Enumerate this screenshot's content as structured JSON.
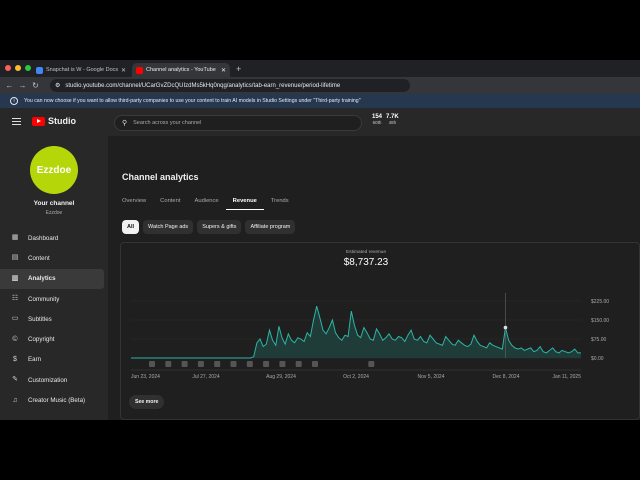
{
  "browser": {
    "tabs": [
      {
        "label": "Snapchat is W - Google Docs",
        "favicon_color": "#4285f4"
      },
      {
        "label": "Channel analytics - YouTube",
        "favicon_color": "#ff0000"
      }
    ],
    "url": "studio.youtube.com/channel/UCarGvZDcQUIzdMs5kHq0nqg/analytics/tab-earn_revenue/period-lifetime"
  },
  "banner": {
    "text": "You can now choose if you want to allow third-party companies to use your content to train AI models in Studio Settings under \"Third-party training\""
  },
  "header": {
    "logo_text": "Studio",
    "search_placeholder": "Search across your channel",
    "stats": [
      {
        "value": "154",
        "label": "60th"
      },
      {
        "value": "7.7K",
        "label": "48h"
      }
    ]
  },
  "sidebar": {
    "avatar_text": "Ezzdoe",
    "channel_label": "Your channel",
    "channel_handle": "Ezzdoe",
    "items": [
      {
        "label": "Dashboard",
        "icon": "dashboard-icon",
        "glyph": "▦"
      },
      {
        "label": "Content",
        "icon": "content-icon",
        "glyph": "▤"
      },
      {
        "label": "Analytics",
        "icon": "analytics-icon",
        "glyph": "▥"
      },
      {
        "label": "Community",
        "icon": "community-icon",
        "glyph": "☷"
      },
      {
        "label": "Subtitles",
        "icon": "subtitles-icon",
        "glyph": "▭"
      },
      {
        "label": "Copyright",
        "icon": "copyright-icon",
        "glyph": "©"
      },
      {
        "label": "Earn",
        "icon": "earn-icon",
        "glyph": "$"
      },
      {
        "label": "Customization",
        "icon": "customization-icon",
        "glyph": "✎"
      },
      {
        "label": "Creator Music (Beta)",
        "icon": "music-icon",
        "glyph": "♫"
      }
    ]
  },
  "main": {
    "title": "Channel analytics",
    "tabs": [
      "Overview",
      "Content",
      "Audience",
      "Revenue",
      "Trends"
    ],
    "chips": [
      "All",
      "Watch Page ads",
      "Supers & gifts",
      "Affiliate program"
    ],
    "metric_label": "Estimated revenue",
    "metric_value": "$8,737.23",
    "see_more": "See more"
  },
  "colors": {
    "accent_line": "#2bb5a5",
    "chip_selected_bg": "#f1f1f1",
    "avatar": "#b5d70a"
  },
  "chart_data": {
    "type": "area",
    "x_tick_labels": [
      "Jun 23, 2024",
      "Jul 27, 2024",
      "Aug 29, 2024",
      "Oct 2, 2024",
      "Nov 5, 2024",
      "Dec 8, 2024",
      "Jan 11, 2025"
    ],
    "y_tick_labels": [
      "$225.00",
      "$150.00",
      "$75.00",
      "$0.00"
    ],
    "ylim": [
      0,
      225
    ],
    "series": [
      {
        "values": [
          0,
          0,
          0,
          0,
          0,
          0,
          0,
          0,
          0,
          0,
          0,
          0,
          0,
          0,
          0,
          0,
          0,
          0,
          0,
          0,
          0,
          0,
          0,
          0,
          0,
          0,
          0,
          0,
          0,
          0,
          0,
          0,
          0,
          0,
          0,
          0,
          0,
          0,
          0,
          5,
          60,
          75,
          45,
          55,
          110,
          70,
          50,
          125,
          80,
          55,
          95,
          70,
          60,
          80,
          75,
          65,
          100,
          85,
          150,
          205,
          160,
          110,
          95,
          120,
          150,
          100,
          80,
          70,
          90,
          85,
          185,
          130,
          90,
          80,
          120,
          100,
          75,
          70,
          115,
          95,
          70,
          80,
          95,
          75,
          70,
          85,
          80,
          65,
          90,
          110,
          75,
          70,
          85,
          65,
          60,
          90,
          75,
          60,
          55,
          50,
          85,
          70,
          55,
          50,
          70,
          60,
          50,
          45,
          55,
          90,
          65,
          50,
          45,
          40,
          60,
          50,
          45,
          40,
          35,
          120,
          70,
          50,
          40,
          35,
          40,
          30,
          35,
          40,
          25,
          30,
          45,
          25,
          20,
          30,
          40,
          25,
          20,
          30,
          25,
          20,
          25,
          35,
          20,
          20
        ]
      }
    ],
    "marker_x_label": "Dec 8, 2024"
  }
}
